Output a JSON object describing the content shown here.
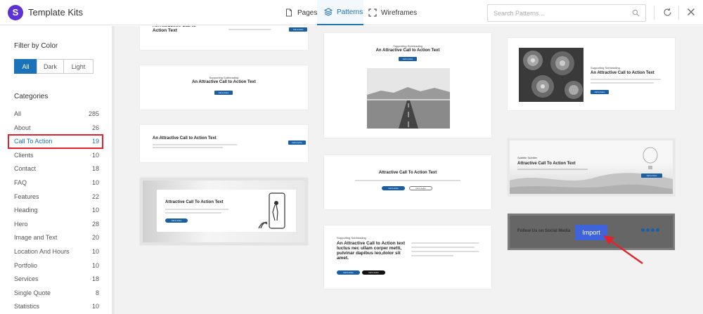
{
  "header": {
    "app_title": "Template Kits",
    "tabs": [
      {
        "label": "Pages",
        "icon": "document-icon"
      },
      {
        "label": "Patterns",
        "icon": "layers-icon",
        "active": true
      },
      {
        "label": "Wireframes",
        "icon": "expand-icon"
      }
    ],
    "search_placeholder": "Search Patterns...",
    "accent_color": "#1a73b9"
  },
  "sidebar": {
    "filter_heading": "Filter by Color",
    "color_filters": [
      {
        "label": "All",
        "active": true
      },
      {
        "label": "Dark",
        "active": false
      },
      {
        "label": "Light",
        "active": false
      }
    ],
    "categories_heading": "Categories",
    "categories": [
      {
        "label": "All",
        "count": "285"
      },
      {
        "label": "About",
        "count": "26"
      },
      {
        "label": "Call To Action",
        "count": "19",
        "active": true
      },
      {
        "label": "Clients",
        "count": "10"
      },
      {
        "label": "Contact",
        "count": "18"
      },
      {
        "label": "FAQ",
        "count": "10"
      },
      {
        "label": "Features",
        "count": "22"
      },
      {
        "label": "Heading",
        "count": "10"
      },
      {
        "label": "Hero",
        "count": "28"
      },
      {
        "label": "Image and Text",
        "count": "20"
      },
      {
        "label": "Location And Hours",
        "count": "10"
      },
      {
        "label": "Portfolio",
        "count": "10"
      },
      {
        "label": "Services",
        "count": "18"
      },
      {
        "label": "Single Quote",
        "count": "8"
      },
      {
        "label": "Statistics",
        "count": "10"
      }
    ]
  },
  "patterns": {
    "c1": {
      "heading": "An Attractive Call to Action Text",
      "button": "Call to Action"
    },
    "c2": {
      "sub": "Supporting Subheading",
      "heading": "An Attractive Call to Action Text",
      "button": "Call to Action"
    },
    "c3": {
      "heading": "An Attractive Call to Action Text",
      "button": "Call to Action"
    },
    "c4": {
      "heading": "Attractive Call To Action Text",
      "button": "Call to Action"
    },
    "c5": {
      "sub": "Supporting Subheading",
      "heading": "An Attractive Call to Action Text",
      "button": "Call to Action"
    },
    "c6": {
      "heading": "Attractive Call To Action Text",
      "button1": "Call to Action",
      "button2": "Call to Action"
    },
    "c7": {
      "sub": "Supporting Subheading",
      "heading": "An Attractive Call to Action text luctus nec ullam corper metti, pulvinar dapibus leo,dolor sit amet.",
      "button1": "Call to Action",
      "button2": "Call to Action"
    },
    "c8": {
      "sub": "Supporting Subheading",
      "heading": "An Attractive Call to Action Text",
      "button": "Call to Action"
    },
    "c9": {
      "sub": "Subtitle Subtitle",
      "heading": "Attractive Call To Action Text",
      "button": "Call to Action"
    },
    "c10": {
      "heading": "Follow Us on Social Media",
      "import_label": "Import"
    }
  }
}
